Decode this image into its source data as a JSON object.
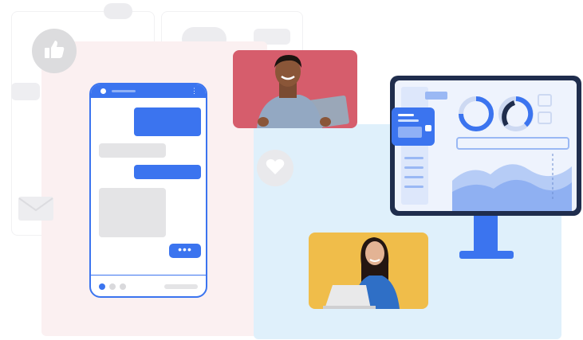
{
  "typing_indicator": "•••",
  "phone_menu_glyph": "⋮",
  "icons": {
    "like": "thumbs-up-icon",
    "heart": "heart-icon",
    "email": "envelope-icon"
  },
  "colors": {
    "accent_blue": "#3b74ef",
    "panel_pink": "#fbf0f1",
    "panel_blue": "#dff0fb",
    "photo_red": "#d65d6c",
    "photo_yellow": "#f0bd4a",
    "monitor_frame": "#1f2d4d"
  }
}
